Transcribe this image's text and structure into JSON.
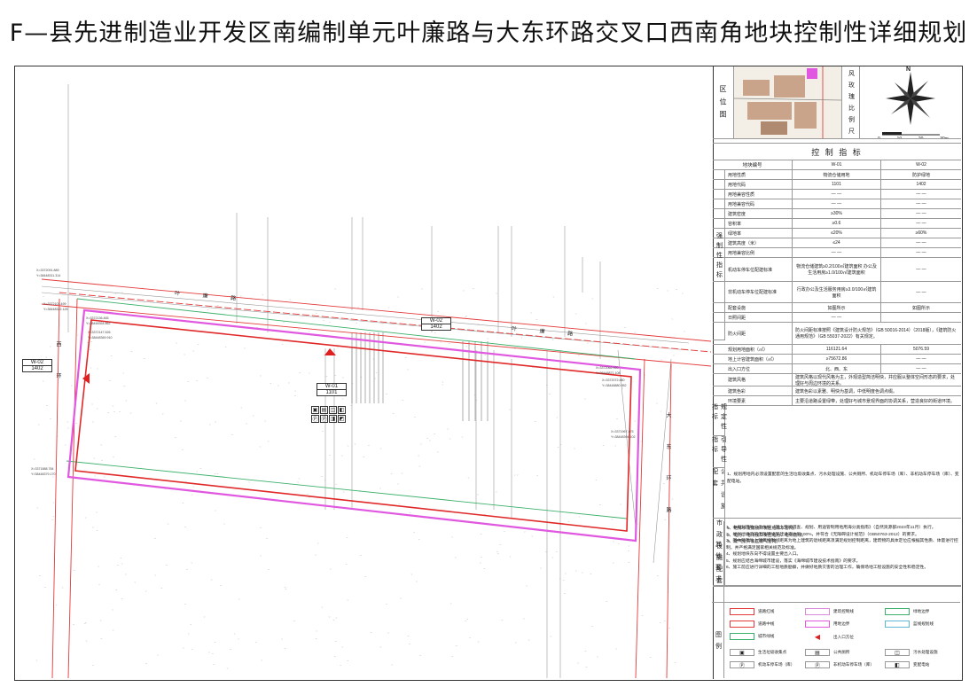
{
  "title": "F—县先进制造业开发区南编制单元叶廉路与大东环路交叉口西南角地块控制性详细规划",
  "map": {
    "road_north": "叶 廉 路",
    "road_north_2": "叶 廉 路",
    "road_east": "大 东 环 路",
    "road_west": "西 环",
    "parcel_w01": {
      "code": "W-01",
      "use_code": "1101"
    },
    "parcel_w02_top": {
      "code": "W-02",
      "use_code": "1402"
    },
    "parcel_w02_left": {
      "code": "W-02",
      "use_code": "1402"
    },
    "coord_labels": [
      "X=3372091.889",
      "Y=38448311.314",
      "X=3372103.499",
      "Y=38448322.125",
      "X=3372136.465",
      "Y=38448354.862",
      "X=3372147.526",
      "Y=38448369.910",
      "X=3372062.920",
      "Y=38448871.108",
      "X=3372072.880",
      "Y=38448880.952",
      "X=3371967.475",
      "Y=38448394.102",
      "X=3371888.784",
      "Y=38448379.170"
    ]
  },
  "panel": {
    "location_label": "区 位 图",
    "wind_label": "风 玫 瑰 比 例 尺",
    "north": "N",
    "scale": [
      "0",
      "10",
      "20",
      "30m"
    ],
    "indicator_title": "控 制 指 标",
    "header": {
      "name": "地块编号",
      "a": "W-01",
      "b": "W-02"
    },
    "section_mandatory": "强 制 性 指 标",
    "section_guiding": "规 定 性 指 标",
    "section_design": "引 导 性 指 标",
    "rows": [
      {
        "name": "用地性质",
        "a": "物流仓储用地",
        "b": "防护绿地"
      },
      {
        "name": "用地代码",
        "a": "1101",
        "b": "1402"
      },
      {
        "name": "用地兼容性质",
        "a": "— —",
        "b": "— —"
      },
      {
        "name": "用地兼容代码",
        "a": "— —",
        "b": "— —"
      },
      {
        "name": "建筑密度",
        "a": "≥30%",
        "b": "— —"
      },
      {
        "name": "容积率",
        "a": "≥0.6",
        "b": "— —"
      },
      {
        "name": "绿地率",
        "a": "≤20%",
        "b": "≥60%"
      },
      {
        "name": "建筑高度（米）",
        "a": "≤24",
        "b": "— —"
      },
      {
        "name": "用地兼容比例",
        "a": "— —",
        "b": "— —"
      },
      {
        "name": "机动车停车位配建标准",
        "a": "物流仓储建筑≥0.2/100㎡建筑面积 办公及生活用房≥1.0/100㎡建筑面积",
        "b": "— —"
      },
      {
        "name": "非机动车停车位配建标准",
        "a": "行政办公及生活服务用房≥3.0/100㎡建筑面积",
        "b": "— —"
      },
      {
        "name": "配套设施",
        "a": "如图所示",
        "b": "如图所示"
      },
      {
        "name": "日照间距",
        "a": "— —",
        "b": ""
      },
      {
        "name": "防火间距",
        "a": "防火间距标准按照《建筑设计防火规范》（GB 50016-2014）（2018版），《建筑防火通用规范》（GB 55037-2022）有关规定。",
        "b": ""
      },
      {
        "name": "规划用地面积（㎡）",
        "a": "116121.64",
        "b": "5076.59"
      },
      {
        "name": "地上计容建筑面积（㎡）",
        "a": "≥75672.86",
        "b": "— —"
      },
      {
        "name": "出入口方位",
        "a": "北、西、东",
        "b": "— —"
      },
      {
        "name": "建筑风格",
        "a": "建筑风格以现代风格为主，外观造型简洁明快，并应服从整体空间形态的要求，处理好与周边环境的关系。",
        "b": ""
      },
      {
        "name": "建筑色彩",
        "a": "建筑色彩以素雅、明快为基调，中低明度色调点缀。",
        "b": ""
      },
      {
        "name": "环境要素",
        "a": "主要沿道路设置绿带，处理好与城市景观界面的协调关系，营造良好的街道环境。",
        "b": ""
      }
    ],
    "public_title": "公 共 设 施 配 套",
    "public_text": "1、规划用地内必须设置配套的生活垃圾收集点、污水处理设施、公共厕所、机动车停车场（库）、非机动车停车场（库）、变配电站。",
    "municipal_title": "市 政 设 施 配 套",
    "municipal_text": [
      "1、给排水设施接开发区给排水管网。",
      "2、电力、电讯接开发区电力、电讯管线。",
      "3、燃气接开发区燃气管网。"
    ],
    "other_title": "其 他 要 求",
    "other_text": [
      "1、本规划用地分类依据《国土空间调查、规划、用途管制用地用海分类指南》（自然资源部2023年11月）执行。",
      "2、规划地块内的无障碍设施建设率达到100%，并符合《无障碍设计规范》（GB50763-2012）的要求。",
      "3、图中所有地上建筑控制线距离为地上建筑的退线距离须满足规划控制距离，建筑物的具体定位应根据其性质、体量进行控制，并严格满足国家相关规范及标准。",
      "4、规划地块东向不得设置主要出入口。",
      "5、规划应结合海绵城市建设，落实《海绵城市建设技术指南》的要求。",
      "6、施工前应进行详细的工程地质勘察，并做好地质灾害的治理工作，确保场地工程设施的安全性和稳定性。"
    ],
    "legend_title": "图 例",
    "legend": [
      {
        "label": "道路红线",
        "color": "#e43a3a"
      },
      {
        "label": "建筑控制线",
        "color": "#d98bd9"
      },
      {
        "label": "绿地边界",
        "color": "#3bb06a"
      },
      {
        "label": "道路中线",
        "color": "#e43a3a"
      },
      {
        "label": "用地边界",
        "color": "#e058e0"
      },
      {
        "label": "蓝线规划线",
        "color": "#5fb7d6"
      },
      {
        "label": "城市绿线",
        "color": "#3bb06a"
      },
      {
        "label": "出入口方位",
        "color": "#e02020"
      }
    ],
    "legend_icons": [
      {
        "sym": "▣",
        "label": "生活垃圾收集点"
      },
      {
        "sym": "▤",
        "label": "公共厕所"
      },
      {
        "sym": "◫",
        "label": "污水处理设施"
      },
      {
        "sym": "Ⓟ",
        "label": "机动车停车场（库）"
      },
      {
        "sym": "Ⓟ",
        "label": "非机动车停车场（库）"
      },
      {
        "sym": "◧",
        "label": "变配电站"
      }
    ]
  }
}
